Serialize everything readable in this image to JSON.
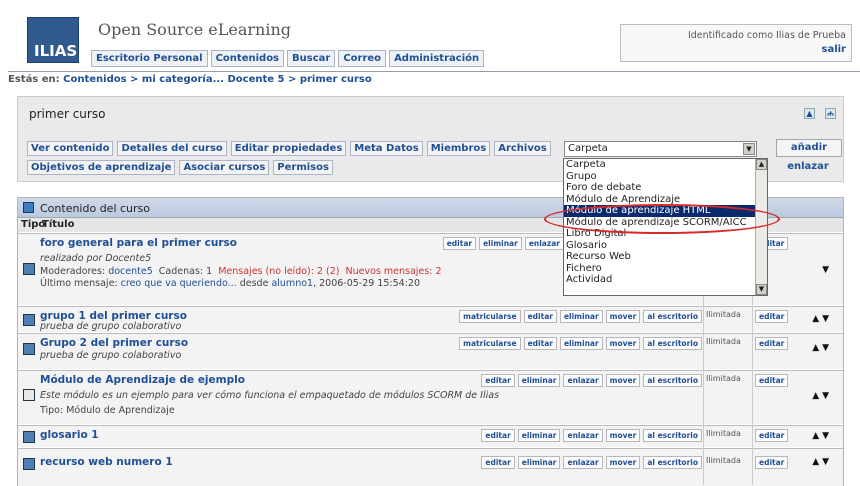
{
  "app": {
    "logo": "ILIAS",
    "name": "Open Source eLearning",
    "user_line": "Identificado como Ilias de Prueba",
    "logout": "salir"
  },
  "mainmenu": [
    "Escritorio Personal",
    "Contenidos",
    "Buscar",
    "Correo",
    "Administración"
  ],
  "breadcrumb": {
    "prefix": "Estás en:",
    "path": "Contenidos > mi categoría... Docente 5 > primer curso"
  },
  "panel": {
    "title": "primer curso",
    "icons": [
      "up-icon",
      "tree-icon"
    ],
    "tabs": [
      "Ver contenido",
      "Detalles del curso",
      "Editar propiedades",
      "Meta Datos",
      "Miembros",
      "Archivos",
      "Objetivos de aprendizaje",
      "Asociar cursos",
      "Permisos"
    ],
    "select_value": "Carpeta",
    "add_label": "añadir",
    "link_label": "enlazar"
  },
  "dropdown": {
    "options": [
      "Carpeta",
      "Grupo",
      "Foro de debate",
      "Módulo de Aprendizaje",
      "Módulo de aprendizaje HTML",
      "Módulo de aprendizaje SCORM/AICC",
      "Libro Digital",
      "Glosario",
      "Recurso Web",
      "Fichero",
      "Actividad"
    ],
    "selected": "Módulo de aprendizaje HTML",
    "highlight_color": "#d62a2a"
  },
  "content": {
    "title": "Contenido del curso",
    "col_tipo": "Tipo",
    "col_titulo": "Título",
    "rows": [
      {
        "title": "foro general para el primer curso",
        "desc": "realizado por Docente5",
        "meta1": "Moderadores:",
        "meta1_link": "docente5",
        "meta1_rest": "Cadenas: 1",
        "meta1_red": "Mensajes (no leído): 2 (2)",
        "meta1_red2": "Nuevos mensajes: 2",
        "meta2": "Último mensaje:",
        "meta2_link": "creo que va queriendo...",
        "meta2_mid": "desde",
        "meta2_link2": "alumno1",
        "meta2_rest": ", 2006-05-29 15:54:20",
        "actions": [
          "editar",
          "eliminar",
          "enlazar"
        ],
        "edit": "editar"
      },
      {
        "title": "grupo 1 del primer curso",
        "desc": "prueba de grupo colaborativo",
        "actions": [
          "matricularse",
          "editar",
          "eliminar",
          "mover",
          "al escritorio"
        ],
        "limit": "Ilimitada",
        "edit": "editar"
      },
      {
        "title": "Grupo 2 del primer curso",
        "desc": "prueba de grupo colaborativo",
        "actions": [
          "matricularse",
          "editar",
          "eliminar",
          "mover",
          "al escritorio"
        ],
        "limit": "Ilimitada",
        "edit": "editar"
      },
      {
        "title": "Módulo de Aprendizaje de ejemplo",
        "desc": "Este módulo es un ejemplo para ver cómo funciona el empaquetado de módulos SCORM de Ilias",
        "meta": "Tipo: Módulo de Aprendizaje",
        "actions": [
          "editar",
          "eliminar",
          "enlazar",
          "mover",
          "al escritorio"
        ],
        "limit": "Ilimitada",
        "edit": "editar"
      },
      {
        "title": "glosario 1",
        "actions": [
          "editar",
          "eliminar",
          "enlazar",
          "mover",
          "al escritorio"
        ],
        "limit": "Ilimitada",
        "edit": "editar"
      },
      {
        "title": "recurso web numero 1",
        "actions": [
          "editar",
          "eliminar",
          "enlazar",
          "mover",
          "al escritorio"
        ],
        "limit": "Ilimitada",
        "edit": "editar"
      }
    ]
  }
}
